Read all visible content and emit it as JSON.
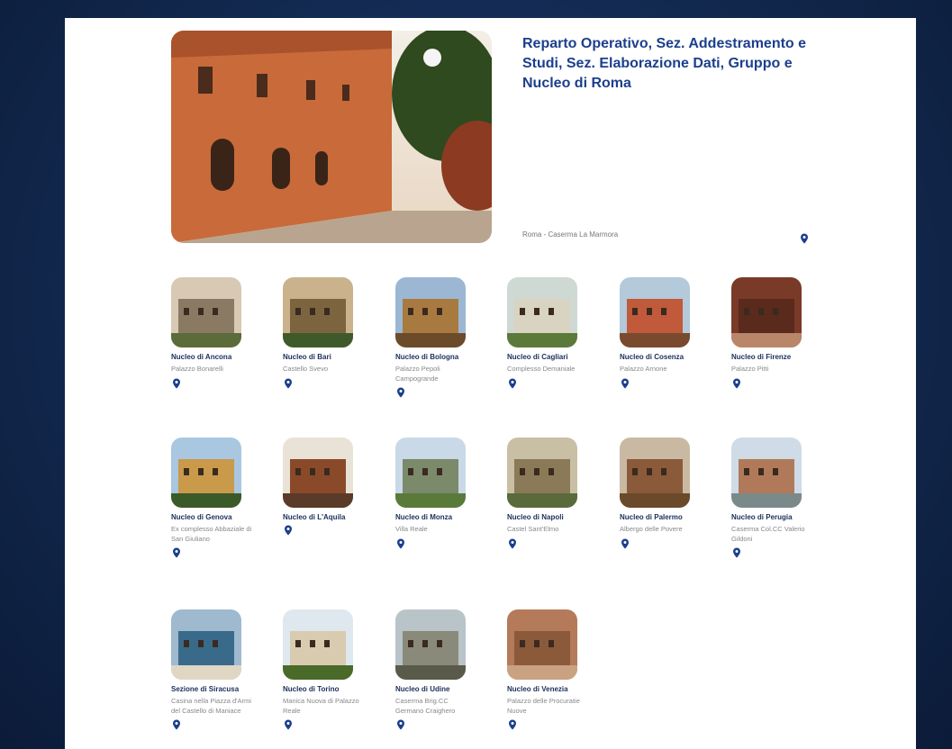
{
  "hero": {
    "title": "Reparto Operativo, Sez. Addestramento e Studi, Sez. Elaborazione Dati, Gruppo e Nucleo di Roma",
    "location": "Roma - Caserma La Marmora",
    "pin_icon": "map-pin-icon"
  },
  "nuclei": [
    {
      "name": "Nucleo di Ancona",
      "place": "Palazzo Bonarelli"
    },
    {
      "name": "Nucleo di Bari",
      "place": "Castello Svevo"
    },
    {
      "name": "Nucleo di Bologna",
      "place": "Palazzo Pepoli Campogrande"
    },
    {
      "name": "Nucleo di Cagliari",
      "place": "Complesso Demaniale"
    },
    {
      "name": "Nucleo di Cosenza",
      "place": "Palazzo Arnone"
    },
    {
      "name": "Nucleo di Firenze",
      "place": "Palazzo Pitti"
    },
    {
      "name": "Nucleo di Genova",
      "place": "Ex complesso Abbaziale di San Giuliano"
    },
    {
      "name": "Nucleo di L'Aquila",
      "place": ""
    },
    {
      "name": "Nucleo di Monza",
      "place": "Villa Reale"
    },
    {
      "name": "Nucleo di Napoli",
      "place": "Castel Sant'Elmo"
    },
    {
      "name": "Nucleo di Palermo",
      "place": "Albergo delle Povere"
    },
    {
      "name": "Nucleo di Perugia",
      "place": "Caserma Col.CC Valerio Gildoni"
    },
    {
      "name": "Sezione di Siracusa",
      "place": "Casina nella Piazza d'Armi del Castello di Maniace"
    },
    {
      "name": "Nucleo di Torino",
      "place": "Manica Nuova di Palazzo Reale"
    },
    {
      "name": "Nucleo di Udine",
      "place": "Caserma Brig.CC Germano Craighero"
    },
    {
      "name": "Nucleo di Venezia",
      "place": "Palazzo delle Procuratie Nuove"
    }
  ],
  "colors": {
    "accent": "#1c3f8c",
    "pin": "#1c3f8c"
  }
}
